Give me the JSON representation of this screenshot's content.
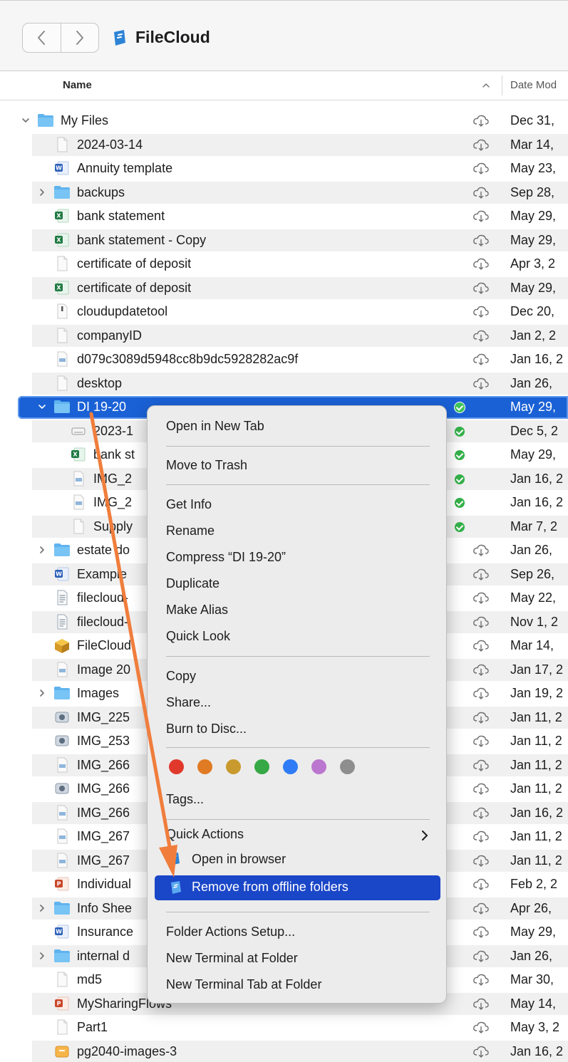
{
  "window": {
    "title": "FileCloud"
  },
  "toolbar": {
    "back_icon": "chevron-left-icon",
    "forward_icon": "chevron-right-icon"
  },
  "columns": {
    "name": "Name",
    "date": "Date Mod"
  },
  "colors": {
    "selection": "#1a61d6",
    "menu_highlight": "#1a46c8",
    "annotation_arrow": "#f07d3c",
    "synced": "#35b24a"
  },
  "rows": [
    {
      "name": "My Files",
      "date": "Dec 31,",
      "icon": "folder-icon",
      "indent": 0,
      "expand": "open",
      "status": "cloud"
    },
    {
      "name": "2024-03-14",
      "date": "Mar 14,",
      "icon": "document-icon",
      "indent": 1,
      "status": "cloud"
    },
    {
      "name": "Annuity template",
      "date": "May 23,",
      "icon": "word-icon",
      "indent": 1,
      "status": "cloud"
    },
    {
      "name": "backups",
      "date": "Sep 28,",
      "icon": "folder-icon",
      "indent": 1,
      "expand": "closed",
      "status": "cloud"
    },
    {
      "name": "bank statement",
      "date": "May 29,",
      "icon": "excel-icon",
      "indent": 1,
      "status": "cloud"
    },
    {
      "name": "bank statement - Copy",
      "date": "May 29,",
      "icon": "excel-icon",
      "indent": 1,
      "status": "cloud"
    },
    {
      "name": "certificate of deposit",
      "date": "Apr 3, 2",
      "icon": "document-icon",
      "indent": 1,
      "status": "cloud"
    },
    {
      "name": "certificate of deposit",
      "date": "May 29,",
      "icon": "excel-icon",
      "indent": 1,
      "status": "cloud"
    },
    {
      "name": "cloudupdatetool",
      "date": "Dec 20,",
      "icon": "executable-icon",
      "indent": 1,
      "status": "cloud"
    },
    {
      "name": "companyID",
      "date": "Jan 2, 2",
      "icon": "document-icon",
      "indent": 1,
      "status": "cloud"
    },
    {
      "name": "d079c3089d5948cc8b9dc5928282ac9f",
      "date": "Jan 16, 2",
      "icon": "image-icon",
      "indent": 1,
      "status": "cloud"
    },
    {
      "name": "desktop",
      "date": "Jan 26,",
      "icon": "document-icon",
      "indent": 1,
      "status": "cloud"
    },
    {
      "name": "DI 19-20",
      "date": "May 29,",
      "icon": "folder-icon",
      "indent": 1,
      "expand": "open",
      "status": "synced",
      "selected": true
    },
    {
      "name": "2023-1",
      "date": "Dec 5, 2",
      "icon": "disk-image-icon",
      "indent": 2,
      "status": "synced"
    },
    {
      "name": "bank st",
      "date": "May 29,",
      "icon": "excel-icon",
      "indent": 2,
      "status": "synced"
    },
    {
      "name": "IMG_2",
      "date": "Jan 16, 2",
      "icon": "image-icon",
      "indent": 2,
      "status": "synced"
    },
    {
      "name": "IMG_2",
      "date": "Jan 16, 2",
      "icon": "image-icon",
      "indent": 2,
      "status": "synced"
    },
    {
      "name": "Supply",
      "date": "Mar 7, 2",
      "icon": "document-icon",
      "indent": 2,
      "status": "synced"
    },
    {
      "name": "estate do",
      "date": "Jan 26,",
      "icon": "folder-icon",
      "indent": 1,
      "expand": "closed",
      "status": "cloud"
    },
    {
      "name": "Example",
      "date": "Sep 26,",
      "icon": "word-icon",
      "indent": 1,
      "status": "cloud"
    },
    {
      "name": "filecloud-",
      "date": "May 22,",
      "icon": "text-icon",
      "indent": 1,
      "status": "cloud"
    },
    {
      "name": "filecloud-",
      "date": "Nov 1, 2",
      "icon": "text-icon",
      "indent": 1,
      "status": "cloud"
    },
    {
      "name": "FileCloud",
      "date": "Mar 14,",
      "icon": "package-icon",
      "indent": 1,
      "status": "cloud"
    },
    {
      "name": "Image 20",
      "date": "Jan 17, 2",
      "icon": "image-icon",
      "indent": 1,
      "status": "cloud"
    },
    {
      "name": "Images",
      "date": "Jan 19, 2",
      "icon": "folder-icon",
      "indent": 1,
      "expand": "closed",
      "status": "cloud"
    },
    {
      "name": "IMG_225",
      "date": "Jan 11, 2",
      "icon": "photo-icon",
      "indent": 1,
      "status": "cloud"
    },
    {
      "name": "IMG_253",
      "date": "Jan 11, 2",
      "icon": "photo-icon",
      "indent": 1,
      "status": "cloud"
    },
    {
      "name": "IMG_266",
      "date": "Jan 11, 2",
      "icon": "image-icon",
      "indent": 1,
      "status": "cloud"
    },
    {
      "name": "IMG_266",
      "date": "Jan 11, 2",
      "icon": "photo-icon",
      "indent": 1,
      "status": "cloud"
    },
    {
      "name": "IMG_266",
      "date": "Jan 16, 2",
      "icon": "image-icon",
      "indent": 1,
      "status": "cloud"
    },
    {
      "name": "IMG_267",
      "date": "Jan 11, 2",
      "icon": "image-icon",
      "indent": 1,
      "status": "cloud"
    },
    {
      "name": "IMG_267",
      "date": "Jan 11, 2",
      "icon": "image-icon",
      "indent": 1,
      "status": "cloud"
    },
    {
      "name": "Individual",
      "date": "Feb 2, 2",
      "icon": "powerpoint-icon",
      "indent": 1,
      "status": "cloud"
    },
    {
      "name": "Info Shee",
      "date": "Apr 26,",
      "icon": "folder-icon",
      "indent": 1,
      "expand": "closed",
      "status": "cloud"
    },
    {
      "name": "Insurance",
      "date": "May 29,",
      "icon": "word-icon",
      "indent": 1,
      "status": "cloud"
    },
    {
      "name": "internal d",
      "date": "Jan 26,",
      "icon": "folder-icon",
      "indent": 1,
      "expand": "closed",
      "status": "cloud"
    },
    {
      "name": "md5",
      "date": "Mar 30,",
      "icon": "document-icon",
      "indent": 1,
      "status": "cloud"
    },
    {
      "name": "MySharingFlows",
      "date": "May 14,",
      "icon": "powerpoint-icon",
      "indent": 1,
      "status": "cloud"
    },
    {
      "name": "Part1",
      "date": "May 3, 2",
      "icon": "document-icon",
      "indent": 1,
      "status": "cloud"
    },
    {
      "name": "pg2040-images-3",
      "date": "Jan 16, 2",
      "icon": "archive-icon",
      "indent": 1,
      "status": "cloud"
    }
  ],
  "context_menu": {
    "open_new_tab": "Open in New Tab",
    "move_to_trash": "Move to Trash",
    "get_info": "Get Info",
    "rename": "Rename",
    "compress": "Compress “DI 19-20”",
    "duplicate": "Duplicate",
    "make_alias": "Make Alias",
    "quick_look": "Quick Look",
    "copy": "Copy",
    "share": "Share...",
    "burn": "Burn to Disc...",
    "tag_colors": [
      "#e0392b",
      "#e07b24",
      "#c99a2e",
      "#36a845",
      "#2f7cf6",
      "#bb76cf",
      "#8e8e8e"
    ],
    "tags": "Tags...",
    "quick_actions": "Quick Actions",
    "open_browser": "Open in browser",
    "remove_offline": "Remove from offline folders",
    "folder_actions": "Folder Actions Setup...",
    "new_terminal": "New Terminal at Folder",
    "new_terminal_tab": "New Terminal Tab at Folder"
  }
}
